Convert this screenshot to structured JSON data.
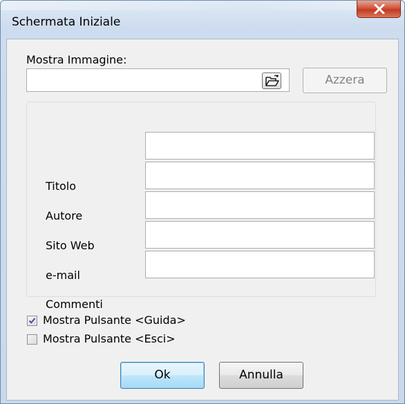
{
  "window": {
    "title": "Schermata Iniziale"
  },
  "image": {
    "label": "Mostra Immagine:",
    "path_value": "",
    "reset_label": "Azzera"
  },
  "fields": [
    {
      "label": "Titolo",
      "value": ""
    },
    {
      "label": "Autore",
      "value": ""
    },
    {
      "label": "Sito Web",
      "value": ""
    },
    {
      "label": "e-mail",
      "value": ""
    },
    {
      "label": "Commenti",
      "value": ""
    }
  ],
  "options": [
    {
      "label": "Mostra Pulsante <Guida>",
      "checked": true
    },
    {
      "label": "Mostra Pulsante <Esci>",
      "checked": false
    }
  ],
  "buttons": {
    "ok": "Ok",
    "cancel": "Annulla"
  },
  "colors": {
    "close_button": "#c13b23",
    "default_button_border": "#3c7fb1"
  }
}
